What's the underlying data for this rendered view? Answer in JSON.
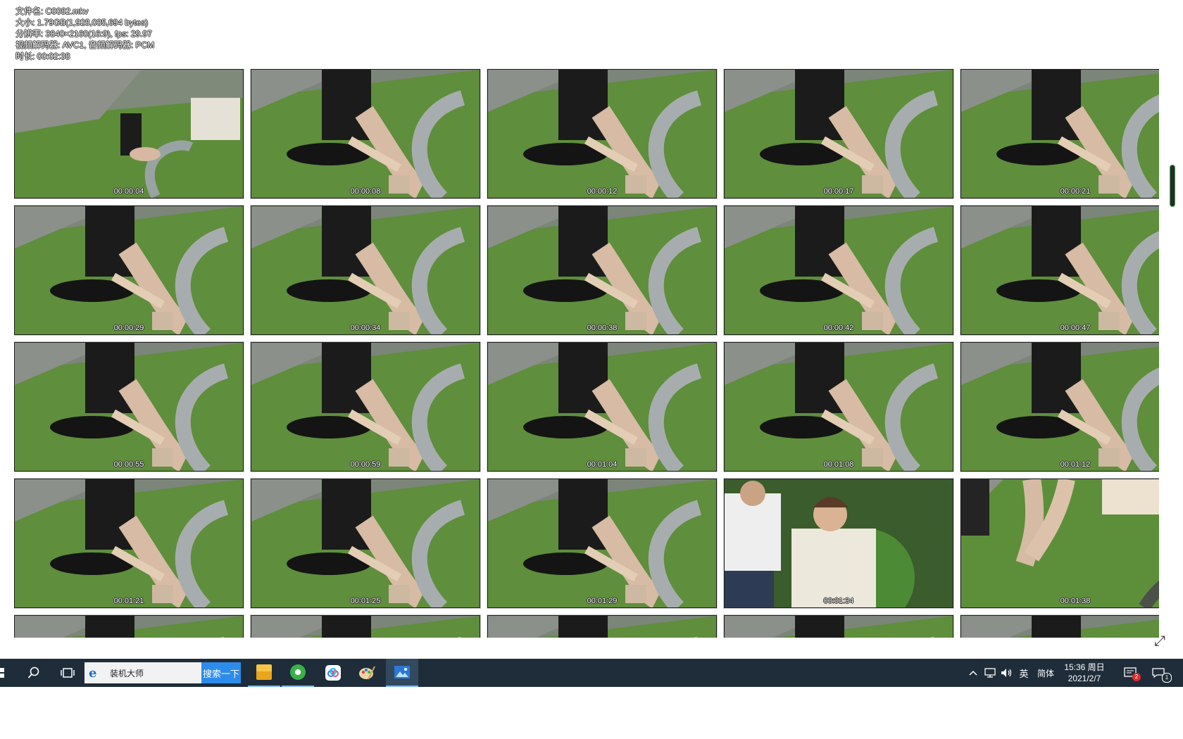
{
  "file_info": {
    "filename": "文件名: C0082.mkv",
    "size": "大小: 1.79GB(1,928,035,694 bytes)",
    "resolution": "分辨率: 3840×2160(16:9), fps: 29.97",
    "codecs": "视频解码器: AVC1, 音频解码器: PCM",
    "duration": "时长: 00:02:38"
  },
  "thumbnails": [
    {
      "time": "00:00:04",
      "variant": 0
    },
    {
      "time": "00:00:08",
      "variant": 1
    },
    {
      "time": "00:00:12",
      "variant": 1
    },
    {
      "time": "00:00:17",
      "variant": 1
    },
    {
      "time": "00:00:21",
      "variant": 1
    },
    {
      "time": "00:00:29",
      "variant": 1
    },
    {
      "time": "00:00:34",
      "variant": 1
    },
    {
      "time": "00:00:38",
      "variant": 1
    },
    {
      "time": "00:00:42",
      "variant": 1
    },
    {
      "time": "00:00:47",
      "variant": 1
    },
    {
      "time": "00:00:55",
      "variant": 1
    },
    {
      "time": "00:00:59",
      "variant": 1
    },
    {
      "time": "00:01:04",
      "variant": 1
    },
    {
      "time": "00:01:08",
      "variant": 1
    },
    {
      "time": "00:01:12",
      "variant": 1
    },
    {
      "time": "00:01:21",
      "variant": 1
    },
    {
      "time": "00:01:25",
      "variant": 1
    },
    {
      "time": "00:01:29",
      "variant": 1
    },
    {
      "time": "00:01:34",
      "variant": 2
    },
    {
      "time": "00:01:38",
      "variant": 3
    },
    {
      "time": "",
      "variant": 1
    },
    {
      "time": "",
      "variant": 1
    },
    {
      "time": "",
      "variant": 1
    },
    {
      "time": "",
      "variant": 1
    },
    {
      "time": "",
      "variant": 1
    }
  ],
  "taskbar": {
    "search_placeholder": "装机大师",
    "search_button": "搜索一下",
    "tray": {
      "ime_lang": "英",
      "ime_mode": "简体",
      "time": "15:36 周日",
      "date": "2021/2/7",
      "notify_badge": "2",
      "msg_badge": "1"
    }
  },
  "colors": {
    "taskbar_bg": "#1f2d3a",
    "search_button_bg": "#2d8ceb",
    "grass": "#5b8f3a",
    "pavement": "#8a8f86"
  },
  "icons": [
    "windows-start-icon",
    "search-icon",
    "task-view-icon",
    "ie-icon",
    "file-explorer-icon",
    "browser-icon",
    "baidu-netdisk-icon",
    "paint-icon",
    "photos-icon",
    "chevron-up-icon",
    "network-icon",
    "volume-icon",
    "notification-icon",
    "message-icon",
    "expand-icon"
  ]
}
